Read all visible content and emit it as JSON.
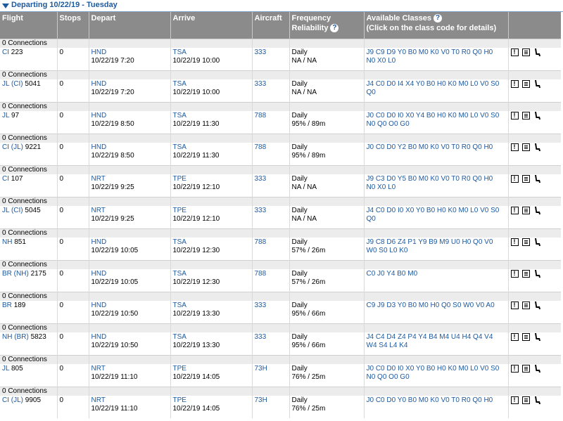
{
  "header": {
    "title": "Departing 10/22/19 - Tuesday"
  },
  "columns": {
    "flight": "Flight",
    "stops": "Stops",
    "depart": "Depart",
    "arrive": "Arrive",
    "aircraft": "Aircraft",
    "frequency_line1": "Frequency",
    "frequency_line2": "Reliability",
    "classes_line1": "Available Classes",
    "classes_line2": "(Click on the class code for details)"
  },
  "connections_label": "0 Connections",
  "icons": [
    "alert-icon",
    "details-icon",
    "seat-icon"
  ],
  "colors": {
    "header_bg": "#8b8b8b",
    "link": "#1e5aa0",
    "connection_bg": "#ececec"
  },
  "flights": [
    {
      "carrier": "CI",
      "number": "223",
      "stops": "0",
      "dep_code": "HND",
      "dep_time": "10/22/19 7:20",
      "arr_code": "TSA",
      "arr_time": "10/22/19 10:00",
      "aircraft": "333",
      "frequency": "Daily",
      "reliability": "NA / NA",
      "classes_1": "J9 C9 D9 Y0 B0 M0 K0 V0 T0 R0 Q0 H0",
      "classes_2": "N0 X0 L0"
    },
    {
      "carrier": "JL (CI)",
      "number": "5041",
      "stops": "0",
      "dep_code": "HND",
      "dep_time": "10/22/19 7:20",
      "arr_code": "TSA",
      "arr_time": "10/22/19 10:00",
      "aircraft": "333",
      "frequency": "Daily",
      "reliability": "NA / NA",
      "classes_1": "J4 C0 D0 I4 X4 Y0 B0 H0 K0 M0 L0 V0 S0",
      "classes_2": "Q0"
    },
    {
      "carrier": "JL",
      "number": "97",
      "stops": "0",
      "dep_code": "HND",
      "dep_time": "10/22/19 8:50",
      "arr_code": "TSA",
      "arr_time": "10/22/19 11:30",
      "aircraft": "788",
      "frequency": "Daily",
      "reliability": "95% / 89m",
      "classes_1": "J0 C0 D0 I0 X0 Y4 B0 H0 K0 M0 L0 V0 S0",
      "classes_2": "N0 Q0 O0 G0"
    },
    {
      "carrier": "CI (JL)",
      "number": "9221",
      "stops": "0",
      "dep_code": "HND",
      "dep_time": "10/22/19 8:50",
      "arr_code": "TSA",
      "arr_time": "10/22/19 11:30",
      "aircraft": "788",
      "frequency": "Daily",
      "reliability": "95% / 89m",
      "classes_1": "J0 C0 D0 Y2 B0 M0 K0 V0 T0 R0 Q0 H0",
      "classes_2": ""
    },
    {
      "carrier": "CI",
      "number": "107",
      "stops": "0",
      "dep_code": "NRT",
      "dep_time": "10/22/19 9:25",
      "arr_code": "TPE",
      "arr_time": "10/22/19 12:10",
      "aircraft": "333",
      "frequency": "Daily",
      "reliability": "NA / NA",
      "classes_1": "J9 C3 D0 Y5 B0 M0 K0 V0 T0 R0 Q0 H0",
      "classes_2": "N0 X0 L0"
    },
    {
      "carrier": "JL (CI)",
      "number": "5045",
      "stops": "0",
      "dep_code": "NRT",
      "dep_time": "10/22/19 9:25",
      "arr_code": "TPE",
      "arr_time": "10/22/19 12:10",
      "aircraft": "333",
      "frequency": "Daily",
      "reliability": "NA / NA",
      "classes_1": "J4 C0 D0 I0 X0 Y0 B0 H0 K0 M0 L0 V0 S0",
      "classes_2": "Q0"
    },
    {
      "carrier": "NH",
      "number": "851",
      "stops": "0",
      "dep_code": "HND",
      "dep_time": "10/22/19 10:05",
      "arr_code": "TSA",
      "arr_time": "10/22/19 12:30",
      "aircraft": "788",
      "frequency": "Daily",
      "reliability": "57% / 26m",
      "classes_1": "J9 C8 D6 Z4 P1 Y9 B9 M9 U0 H0 Q0 V0",
      "classes_2": "W0 S0 L0 K0"
    },
    {
      "carrier": "BR (NH)",
      "number": "2175",
      "stops": "0",
      "dep_code": "HND",
      "dep_time": "10/22/19 10:05",
      "arr_code": "TSA",
      "arr_time": "10/22/19 12:30",
      "aircraft": "788",
      "frequency": "Daily",
      "reliability": "57% / 26m",
      "classes_1": "C0 J0 Y4 B0 M0",
      "classes_2": ""
    },
    {
      "carrier": "BR",
      "number": "189",
      "stops": "0",
      "dep_code": "HND",
      "dep_time": "10/22/19 10:50",
      "arr_code": "TSA",
      "arr_time": "10/22/19 13:30",
      "aircraft": "333",
      "frequency": "Daily",
      "reliability": "95% / 66m",
      "classes_1": "C9 J9 D3 Y0 B0 M0 H0 Q0 S0 W0 V0 A0",
      "classes_2": ""
    },
    {
      "carrier": "NH (BR)",
      "number": "5823",
      "stops": "0",
      "dep_code": "HND",
      "dep_time": "10/22/19 10:50",
      "arr_code": "TSA",
      "arr_time": "10/22/19 13:30",
      "aircraft": "333",
      "frequency": "Daily",
      "reliability": "95% / 66m",
      "classes_1": "J4 C4 D4 Z4 P4 Y4 B4 M4 U4 H4 Q4 V4",
      "classes_2": "W4 S4 L4 K4"
    },
    {
      "carrier": "JL",
      "number": "805",
      "stops": "0",
      "dep_code": "NRT",
      "dep_time": "10/22/19 11:10",
      "arr_code": "TPE",
      "arr_time": "10/22/19 14:05",
      "aircraft": "73H",
      "frequency": "Daily",
      "reliability": "76% / 25m",
      "classes_1": "J0 C0 D0 I0 X0 Y0 B0 H0 K0 M0 L0 V0 S0",
      "classes_2": "N0 Q0 O0 G0"
    },
    {
      "carrier": "CI (JL)",
      "number": "9905",
      "stops": "0",
      "dep_code": "NRT",
      "dep_time": "10/22/19 11:10",
      "arr_code": "TPE",
      "arr_time": "10/22/19 14:05",
      "aircraft": "73H",
      "frequency": "Daily",
      "reliability": "76% / 25m",
      "classes_1": "J0 C0 D0 Y0 B0 M0 K0 V0 T0 R0 Q0 H0",
      "classes_2": ""
    }
  ]
}
